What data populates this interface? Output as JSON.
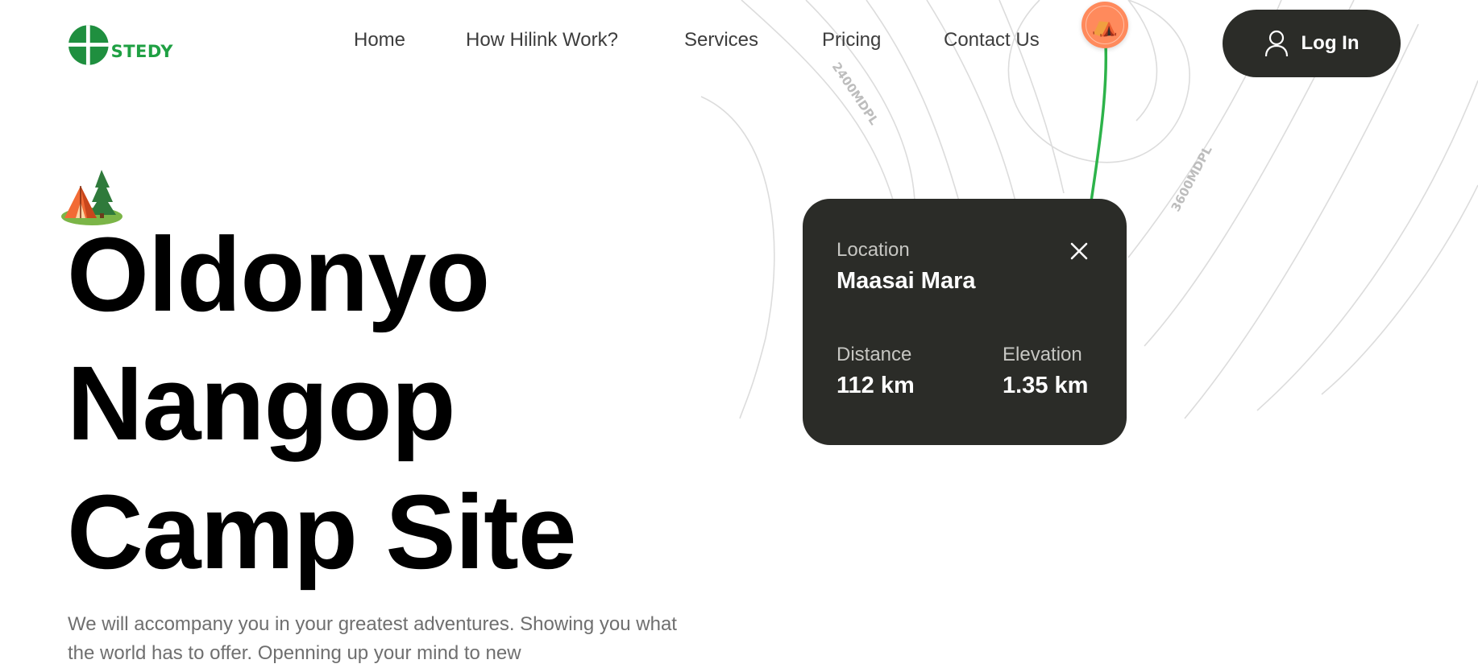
{
  "brand": {
    "name": "STEDY",
    "logo_color": "#1fa043"
  },
  "nav": {
    "items": [
      {
        "label": "Home"
      },
      {
        "label": "How Hilink Work?"
      },
      {
        "label": "Services"
      },
      {
        "label": "Pricing"
      },
      {
        "label": "Contact Us"
      }
    ]
  },
  "login": {
    "label": "Log In",
    "icon": "user-icon"
  },
  "map": {
    "contour_labels": [
      "2400MDPL",
      "3600MDPL"
    ],
    "pin_icon": "camping-tent-icon",
    "route_color": "#2db34a",
    "pin_color": "#ff8a5c"
  },
  "hero": {
    "icon": "camping-tent-icon",
    "title_lines": [
      "Oldonyo",
      "Nangop",
      "Camp Site"
    ],
    "description": "We will accompany you in your greatest adventures. Showing you what the world has to offer. Openning up your mind to new"
  },
  "location_card": {
    "location_label": "Location",
    "location_value": "Maasai Mara",
    "distance_label": "Distance",
    "distance_value": "112 km",
    "elevation_label": "Elevation",
    "elevation_value": "1.35 km",
    "close_icon": "close-icon",
    "background": "#2b2c28"
  }
}
